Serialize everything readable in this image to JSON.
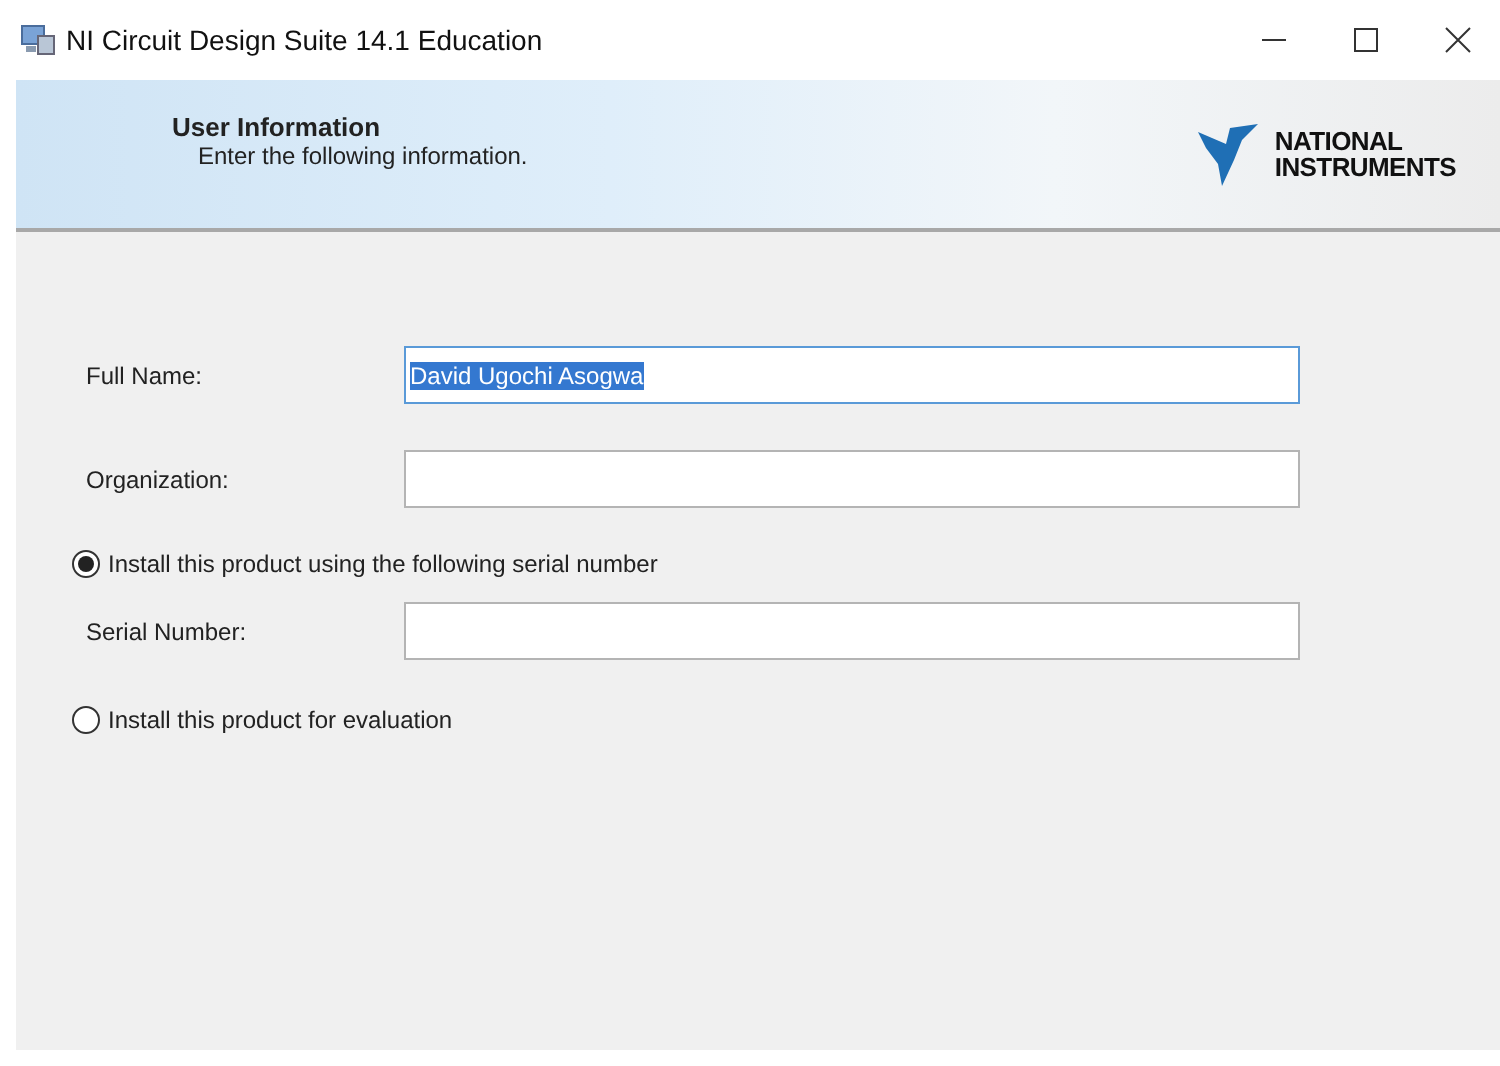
{
  "window": {
    "title": "NI Circuit Design Suite 14.1 Education"
  },
  "header": {
    "title": "User Information",
    "subtitle": "Enter the following information.",
    "logo": [
      "NATIONAL",
      "INSTRUMENTS"
    ]
  },
  "form": [
    {
      "kind": "field",
      "label": "Full Name:",
      "value": "David Ugochi Asogwa",
      "focused": true
    },
    {
      "kind": "field",
      "label": "Organization:",
      "focused": false
    },
    {
      "kind": "radio",
      "label": "Install this product using the following serial number",
      "selected": true
    },
    {
      "kind": "field",
      "label": "Serial Number:",
      "focused": false
    },
    {
      "kind": "radio",
      "label": "Install this product for evaluation",
      "selected": false
    }
  ]
}
